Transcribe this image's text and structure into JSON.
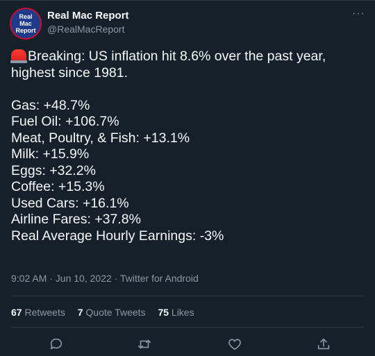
{
  "author": {
    "avatar_lines": [
      "Real",
      "Mac",
      "Report"
    ],
    "name": "Real Mac Report",
    "handle": "@RealMacReport"
  },
  "tweet": {
    "headline_lines": [
      "Breaking: US inflation hit 8.6% over the past year,",
      "highest since 1981."
    ],
    "items": [
      "Gas: +48.7%",
      "Fuel Oil: +106.7%",
      "Meat, Poultry, & Fish: +13.1%",
      "Milk: +15.9%",
      "Eggs: +32.2%",
      "Coffee: +15.3%",
      "Used Cars: +16.1%",
      "Airline Fares: +37.8%",
      "Real Average Hourly Earnings: -3%"
    ],
    "meta": "9:02 AM · Jun 10, 2022 · Twitter for Android"
  },
  "stats": {
    "retweets_count": "67",
    "retweets_label": "Retweets",
    "quotes_count": "7",
    "quotes_label": "Quote Tweets",
    "likes_count": "75",
    "likes_label": "Likes"
  },
  "icons": {
    "siren": "rotating-light-emoji",
    "more": "ellipsis-icon",
    "reply": "reply-icon",
    "retweet": "retweet-icon",
    "like": "heart-icon",
    "share": "share-icon"
  },
  "colors": {
    "background": "#15202b",
    "text": "#f7f9f9",
    "muted": "#8b98a5",
    "divider": "#2f3b47"
  }
}
